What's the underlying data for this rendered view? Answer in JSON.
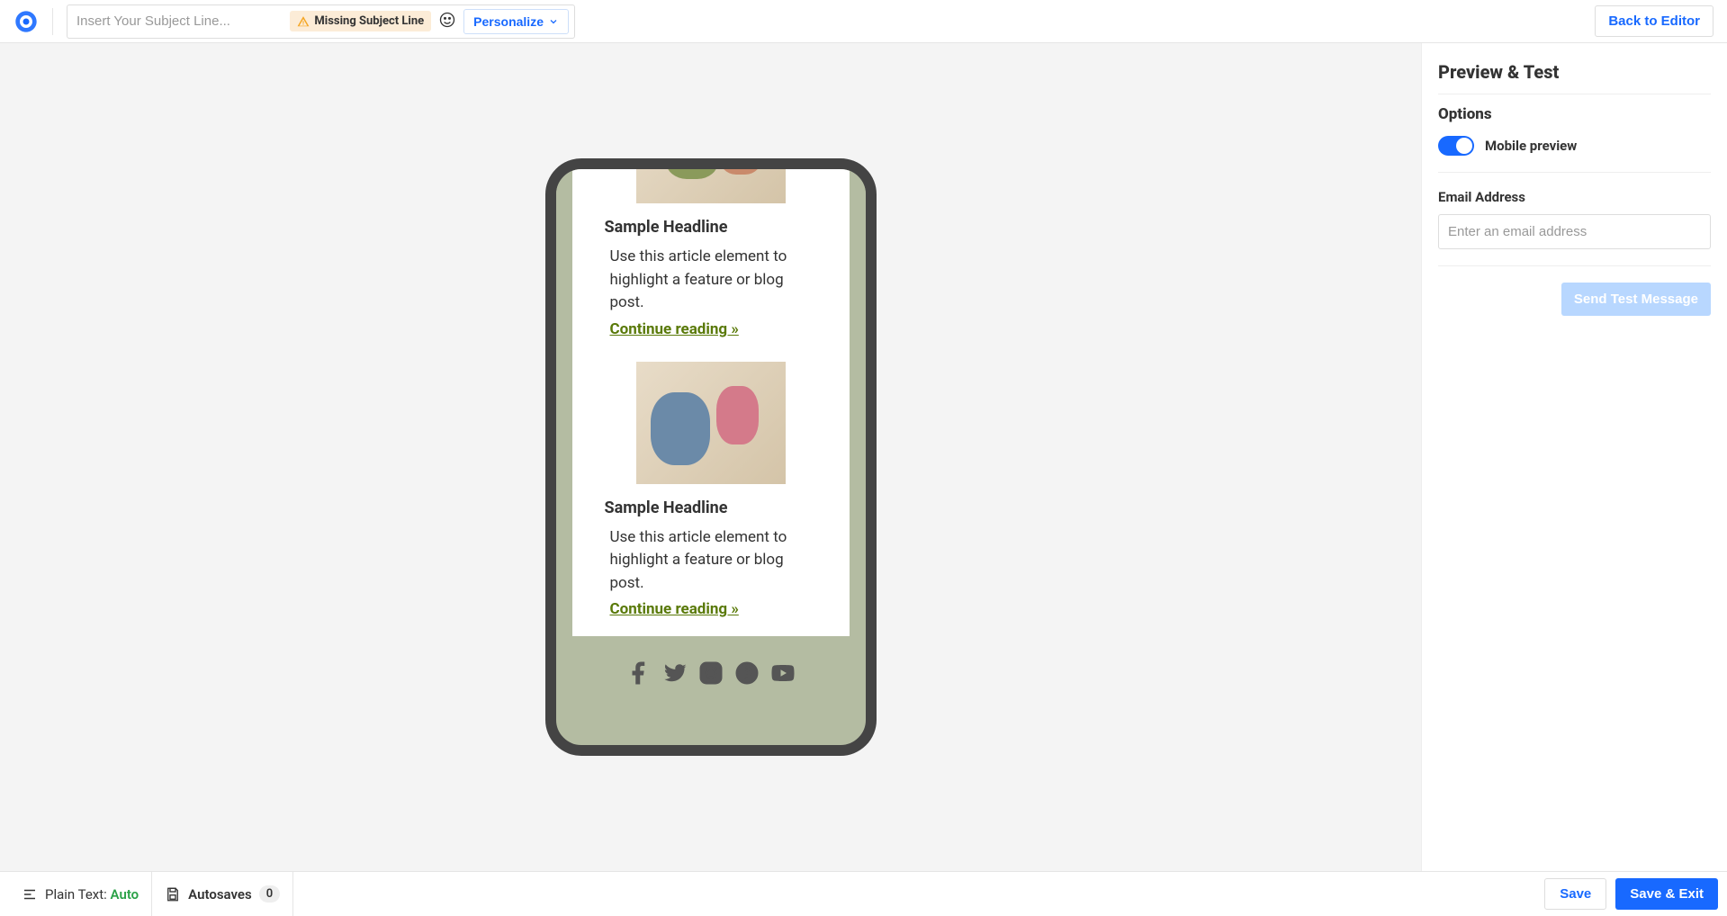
{
  "header": {
    "subject_placeholder": "Insert Your Subject Line...",
    "missing_subject": "Missing Subject Line",
    "personalize": "Personalize",
    "back_to_editor": "Back to Editor"
  },
  "preview_email": {
    "articles": [
      {
        "headline": "Sample Headline",
        "body": "Use this article element to highlight a feature or blog post.",
        "cta": "Continue reading »"
      },
      {
        "headline": "Sample Headline",
        "body": "Use this article element to highlight a feature or blog post.",
        "cta": "Continue reading »"
      }
    ]
  },
  "side": {
    "title": "Preview & Test",
    "options": "Options",
    "mobile_preview": "Mobile preview",
    "email_label": "Email Address",
    "email_placeholder": "Enter an email address",
    "send_test": "Send Test Message"
  },
  "footer": {
    "plain_text_label": "Plain Text: ",
    "plain_text_mode": "Auto",
    "autosaves_label": "Autosaves",
    "autosaves_count": "0",
    "save": "Save",
    "save_exit": "Save & Exit"
  }
}
